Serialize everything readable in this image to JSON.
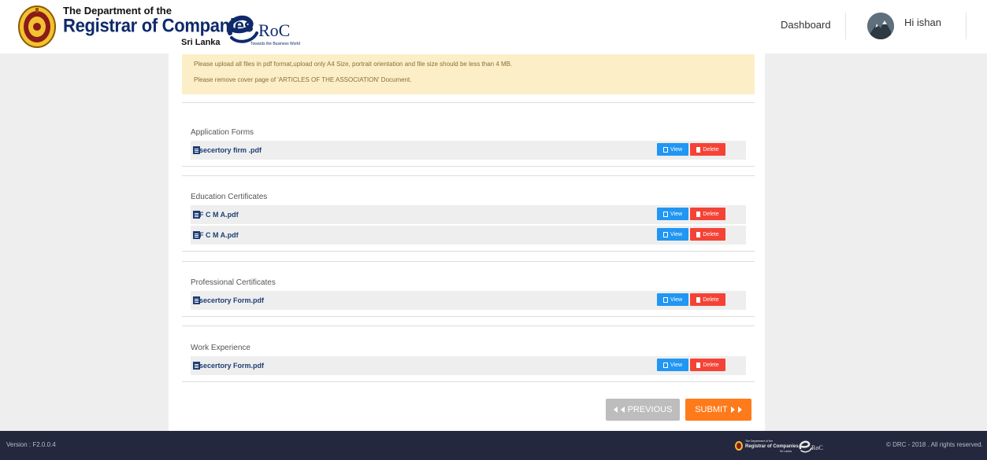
{
  "header": {
    "brand_top": "The Department of the",
    "brand_main": "Registrar of Companies",
    "brand_sub": "Sri Lanka",
    "eroc_text": "RoC",
    "eroc_tagline": "Towards the Business World",
    "nav_dashboard": "Dashboard",
    "greeting": "Hi ishan"
  },
  "notice": {
    "line1": "Please upload all files in pdf format,upload only A4 Size, portrait orientation and file size should be less than 4 MB.",
    "line2": "Please remove cover page of 'ARTICLES OF THE ASSOCIATION' Document."
  },
  "sections": [
    {
      "title": "Application Forms",
      "files": [
        "secertory firm .pdf"
      ]
    },
    {
      "title": "Education Certificates",
      "files": [
        "F C M A.pdf",
        "F C M A.pdf"
      ]
    },
    {
      "title": "Professional Certificates",
      "files": [
        "secertory Form.pdf"
      ]
    },
    {
      "title": "Work Experience",
      "files": [
        "secertory Form.pdf"
      ]
    }
  ],
  "buttons": {
    "view": "View",
    "delete": "Delete",
    "previous": "PREVIOUS",
    "submit": "SUBMIT"
  },
  "footer": {
    "version": "Version : F2.0.0.4",
    "copyright": "© DRC - 2018 . All rights reserved."
  },
  "icons": {
    "seal": "sri-lanka-emblem-icon",
    "file": "pdf-file-icon",
    "view": "document-icon",
    "delete": "trash-icon",
    "previous": "double-chevron-left-icon",
    "submit": "double-chevron-right-icon"
  },
  "colors": {
    "brand_navy": "#0f2a6b",
    "view_blue": "#2196f3",
    "delete_red": "#f44336",
    "submit_orange": "#ff7a1a",
    "notice_bg": "#fcefc7",
    "footer_bg": "#23283f"
  }
}
